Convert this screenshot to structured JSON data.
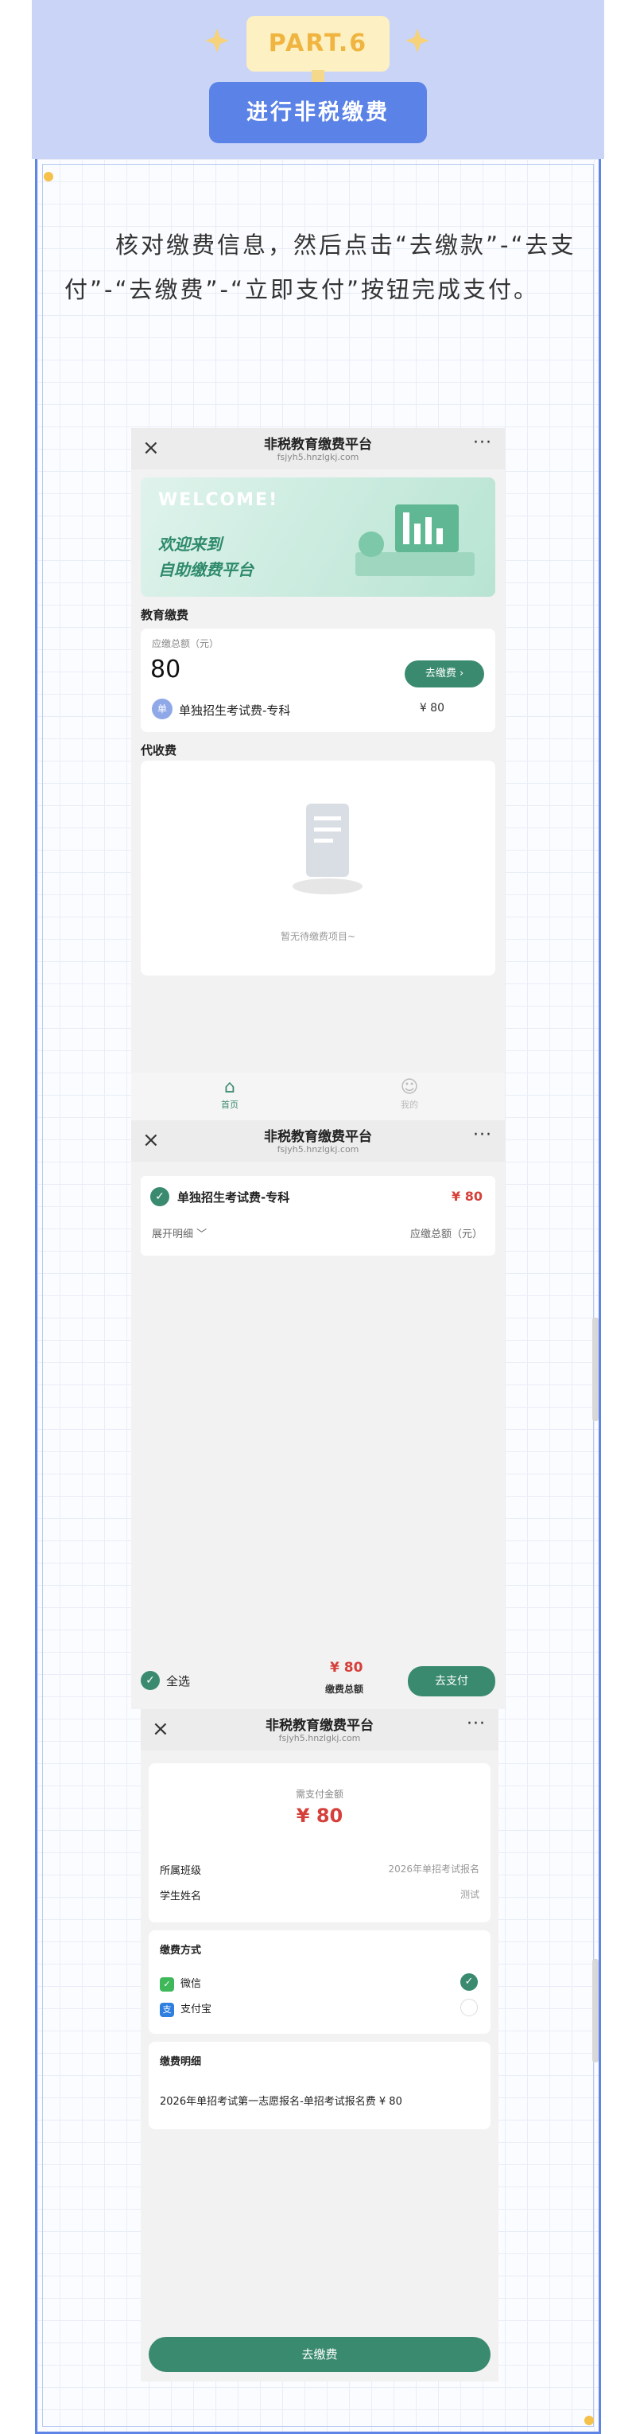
{
  "header": {
    "part_label": "PART.6",
    "title": "进行非税缴费"
  },
  "intro_text": "核对缴费信息，然后点击“去缴款”-“去支付”-“去缴费”-“立即支付”按钮完成支付。",
  "colors": {
    "header_band": "#c9d4f6",
    "accent_blue": "#5b82e6",
    "badge_bg": "#fdf0c2",
    "badge_text": "#f0b540",
    "green": "#3a8a70",
    "price_red": "#d6403a"
  },
  "app": {
    "nav_title": "非税教育缴费平台",
    "nav_subtitle": "fsjyh5.hnzlgkj.com",
    "close_icon": "×",
    "more_icon": "···"
  },
  "screen1": {
    "banner_welcome": "WELCOME!",
    "banner_line1": "欢迎来到",
    "banner_line2": "自助缴费平台",
    "section_edu": "教育缴费",
    "due_label": "应缴总额（元）",
    "due_amount": "80",
    "pay_button": "去缴费 ›",
    "item_name": "单独招生考试费-专科",
    "item_price": "¥ 80",
    "section_collect": "代收费",
    "empty_text": "暂无待缴费项目~",
    "tab_home": "首页",
    "tab_me": "我的"
  },
  "screen2": {
    "item_name": "单独招生考试费-专科",
    "item_price": "¥ 80",
    "expand": "展开明细 ﹀",
    "total_label": "应缴总额（元）",
    "select_all": "全选",
    "sum": "¥ 80",
    "sum_label": "缴费总额",
    "pay_button": "去支付"
  },
  "screen3": {
    "amount_label": "需支付金额",
    "amount": "¥ 80",
    "class_label": "所属班级",
    "class_value": "2026年单招考试报名",
    "student_label": "学生姓名",
    "student_value": "测试",
    "method_header": "缴费方式",
    "wechat": "微信",
    "alipay": "支付宝",
    "detail_header": "缴费明细",
    "detail_value": "2026年单招考试第一志愿报名-单招考试报名费 ¥ 80",
    "pay_button": "去缴费"
  }
}
